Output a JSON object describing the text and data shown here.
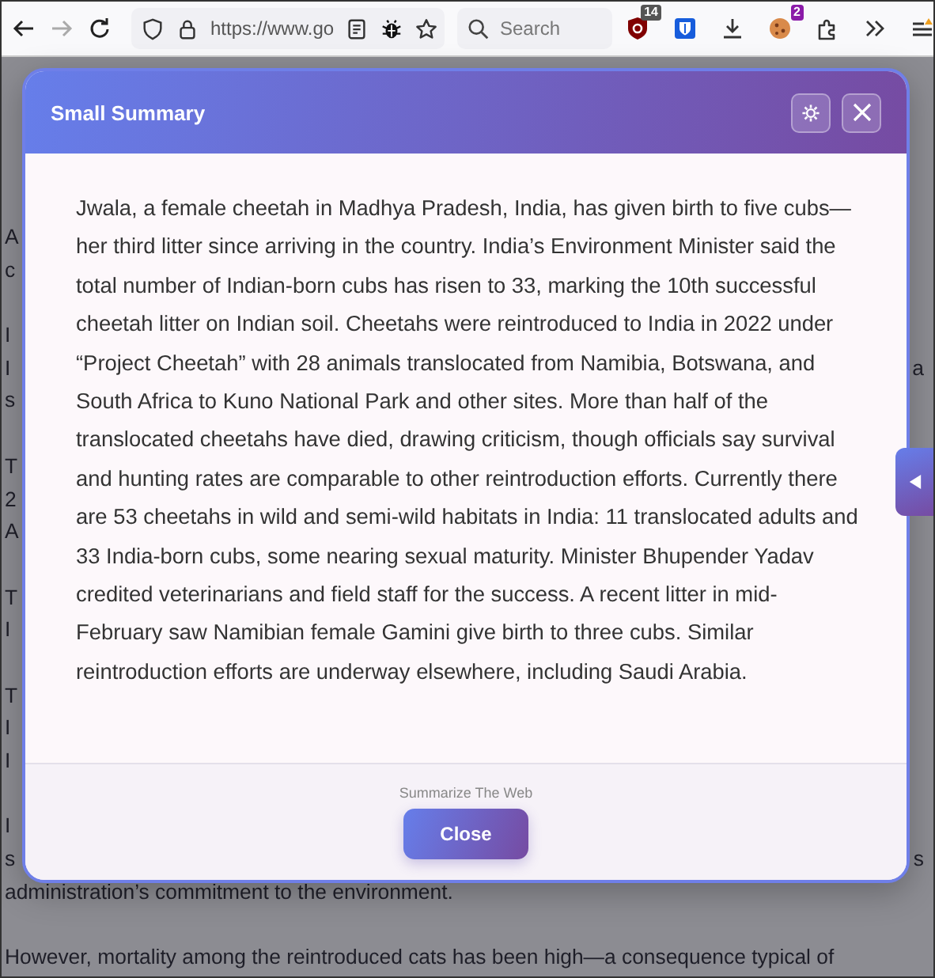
{
  "browser": {
    "forward_enabled": false,
    "url": "https://www.go",
    "search": {
      "placeholder": "Search"
    },
    "extensions": [
      {
        "kind": "ublock",
        "badge": "14"
      },
      {
        "kind": "vault"
      },
      {
        "kind": "download"
      },
      {
        "kind": "cookie",
        "badge": "2"
      },
      {
        "kind": "puzzle"
      }
    ]
  },
  "page": {
    "paragraphs": [
      [
        {
          "text": "A"
        },
        {
          "text": "c"
        }
      ],
      [
        {
          "text": "I"
        },
        {
          "text": "I",
          "right": "a"
        },
        {
          "text": "s"
        }
      ],
      [
        {
          "text": "T"
        },
        {
          "text": "2"
        },
        {
          "text": "A"
        }
      ],
      [
        {
          "text": "T"
        },
        {
          "text": "I"
        }
      ],
      [
        {
          "text": "T"
        },
        {
          "text": "I"
        },
        {
          "text": "I"
        }
      ],
      [
        {
          "text": "I"
        },
        {
          "text": "s",
          "right": "s"
        },
        {
          "text": "administration’s commitment to the environment."
        }
      ],
      [
        {
          "text": "However, mortality among the reintroduced cats has been high—a consequence typical of"
        }
      ]
    ]
  },
  "modal": {
    "title": "Small Summary",
    "summary": "Jwala, a female cheetah in Madhya Pradesh, India, has given birth to five cubs—her third litter since arriving in the country. India’s Environment Minister said the total number of Indian-born cubs has risen to 33, marking the 10th successful cheetah litter on Indian soil. Cheetahs were reintroduced to India in 2022 under “Project Cheetah” with 28 animals translocated from Namibia, Botswana, and South Africa to Kuno National Park and other sites. More than half of the translocated cheetahs have died, drawing criticism, though officials say survival and hunting rates are comparable to other reintroduction efforts. Currently there are 53 cheetahs in wild and semi-wild habitats in India: 11 translocated adults and 33 India-born cubs, some nearing sexual maturity. Minister Bhupender Yadav credited veterinarians and field staff for the success. A recent litter in mid-February saw Namibian female Gamini give birth to three cubs. Similar reintroduction efforts are underway elsewhere, including Saudi Arabia.",
    "footer_label": "Summarize The Web",
    "close_button": "Close"
  }
}
